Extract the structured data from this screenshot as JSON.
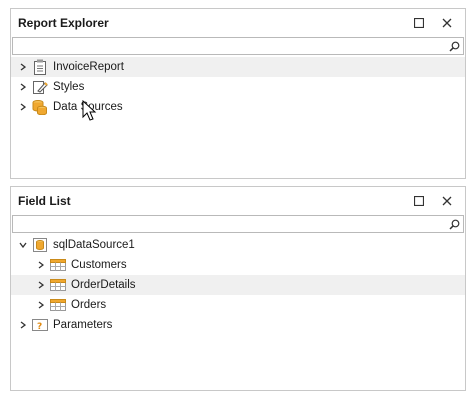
{
  "report_explorer": {
    "title": "Report Explorer",
    "search_placeholder": "",
    "items": [
      {
        "label": "InvoiceReport",
        "icon": "report-icon"
      },
      {
        "label": "Styles",
        "icon": "styles-icon"
      },
      {
        "label": "Data Sources",
        "icon": "datasource-icon"
      }
    ]
  },
  "field_list": {
    "title": "Field List",
    "search_placeholder": "",
    "datasource": {
      "label": "sqlDataSource1",
      "icon": "database-icon"
    },
    "tables": [
      {
        "label": "Customers",
        "icon": "table-icon"
      },
      {
        "label": "OrderDetails",
        "icon": "table-icon"
      },
      {
        "label": "Orders",
        "icon": "table-icon"
      }
    ],
    "parameters": {
      "label": "Parameters",
      "icon": "parameters-icon"
    }
  },
  "colors": {
    "border": "#c8c8c8",
    "hover_row": "#f0f0f0",
    "icon_orange": "#f0a830",
    "icon_gray": "#808080"
  }
}
